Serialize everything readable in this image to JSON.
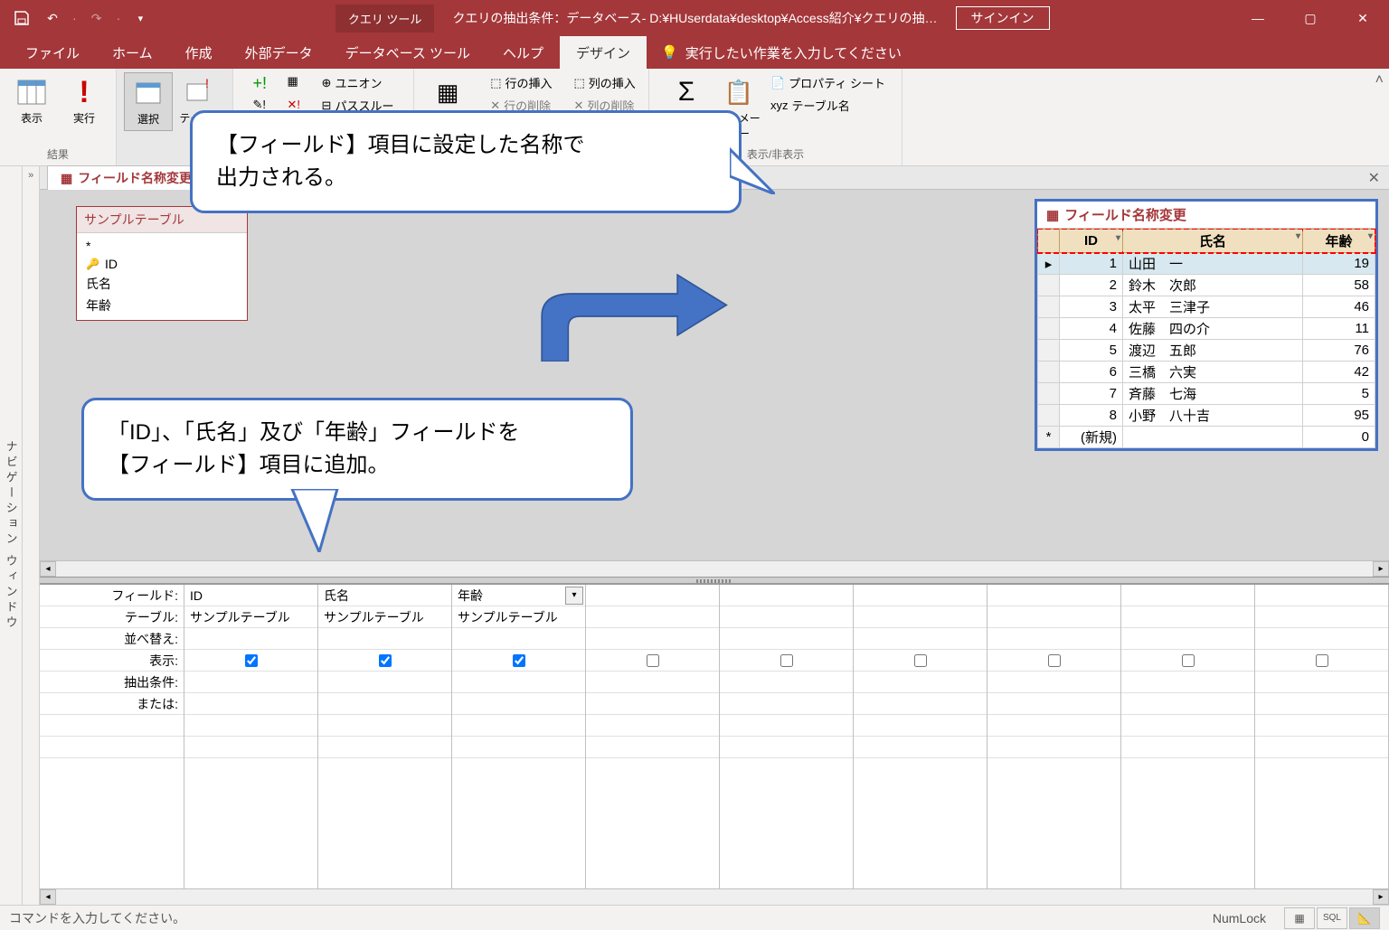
{
  "titlebar": {
    "tool_tab": "クエリ ツール",
    "title": "クエリの抽出条件：データベース- D:¥HUserdata¥desktop¥Access紹介¥クエリの抽…",
    "signin": "サインイン"
  },
  "ribbon_tabs": [
    "ファイル",
    "ホーム",
    "作成",
    "外部データ",
    "データベース ツール",
    "ヘルプ",
    "デザイン"
  ],
  "tell_me": "実行したい作業を入力してください",
  "ribbon": {
    "group_results": {
      "label": "結果",
      "view": "表示",
      "run": "実行"
    },
    "group_querytype": {
      "select": "選択",
      "make": "テーブルの\n作"
    },
    "group_setup": {
      "union": "ユニオン",
      "passthrough": "パススルー",
      "insert_rows": "行の挿入",
      "delete_rows": "行の削除",
      "insert_cols": "列の挿入",
      "delete_cols": "列の削除"
    },
    "group_showhide": {
      "label": "表示/非表示",
      "totals": "集計",
      "params": "パラメーター",
      "prop": "プロパティ シート",
      "tblnames": "テーブル名"
    }
  },
  "query_tab": "フィールド名称変更",
  "table_box": {
    "title": "サンプルテーブル",
    "fields": [
      "*",
      "ID",
      "氏名",
      "年齢"
    ]
  },
  "callout1_l1": "【フィールド】項目に設定した名称で",
  "callout1_l2": "出力される。",
  "callout2_l1": "「ID」、「氏名」及び「年齢」フィールドを",
  "callout2_l2": "【フィールド】項目に追加。",
  "datasheet": {
    "tab": "フィールド名称変更",
    "headers": [
      "ID",
      "氏名",
      "年齢"
    ],
    "rows": [
      {
        "id": "1",
        "name": "山田　一",
        "age": "19",
        "sel": true
      },
      {
        "id": "2",
        "name": "鈴木　次郎",
        "age": "58"
      },
      {
        "id": "3",
        "name": "太平　三津子",
        "age": "46"
      },
      {
        "id": "4",
        "name": "佐藤　四の介",
        "age": "11"
      },
      {
        "id": "5",
        "name": "渡辺　五郎",
        "age": "76"
      },
      {
        "id": "6",
        "name": "三橋　六実",
        "age": "42"
      },
      {
        "id": "7",
        "name": "斉藤　七海",
        "age": "5"
      },
      {
        "id": "8",
        "name": "小野　八十吉",
        "age": "95"
      }
    ],
    "new_row": "(新規)",
    "new_age": "0"
  },
  "qgrid": {
    "labels": [
      "フィールド:",
      "テーブル:",
      "並べ替え:",
      "表示:",
      "抽出条件:",
      "または:"
    ],
    "cols": [
      {
        "field": "ID",
        "table": "サンプルテーブル",
        "show": true
      },
      {
        "field": "氏名",
        "table": "サンプルテーブル",
        "show": true
      },
      {
        "field": "年齢",
        "table": "サンプルテーブル",
        "show": true,
        "sel": true
      },
      {
        "field": "",
        "table": "",
        "show": false
      },
      {
        "field": "",
        "table": "",
        "show": false
      },
      {
        "field": "",
        "table": "",
        "show": false
      },
      {
        "field": "",
        "table": "",
        "show": false
      },
      {
        "field": "",
        "table": "",
        "show": false
      },
      {
        "field": "",
        "table": "",
        "show": false
      }
    ]
  },
  "statusbar": {
    "msg": "コマンドを入力してください。",
    "numlock": "NumLock"
  },
  "nav_pane": "ナビゲーション ウィンドウ"
}
